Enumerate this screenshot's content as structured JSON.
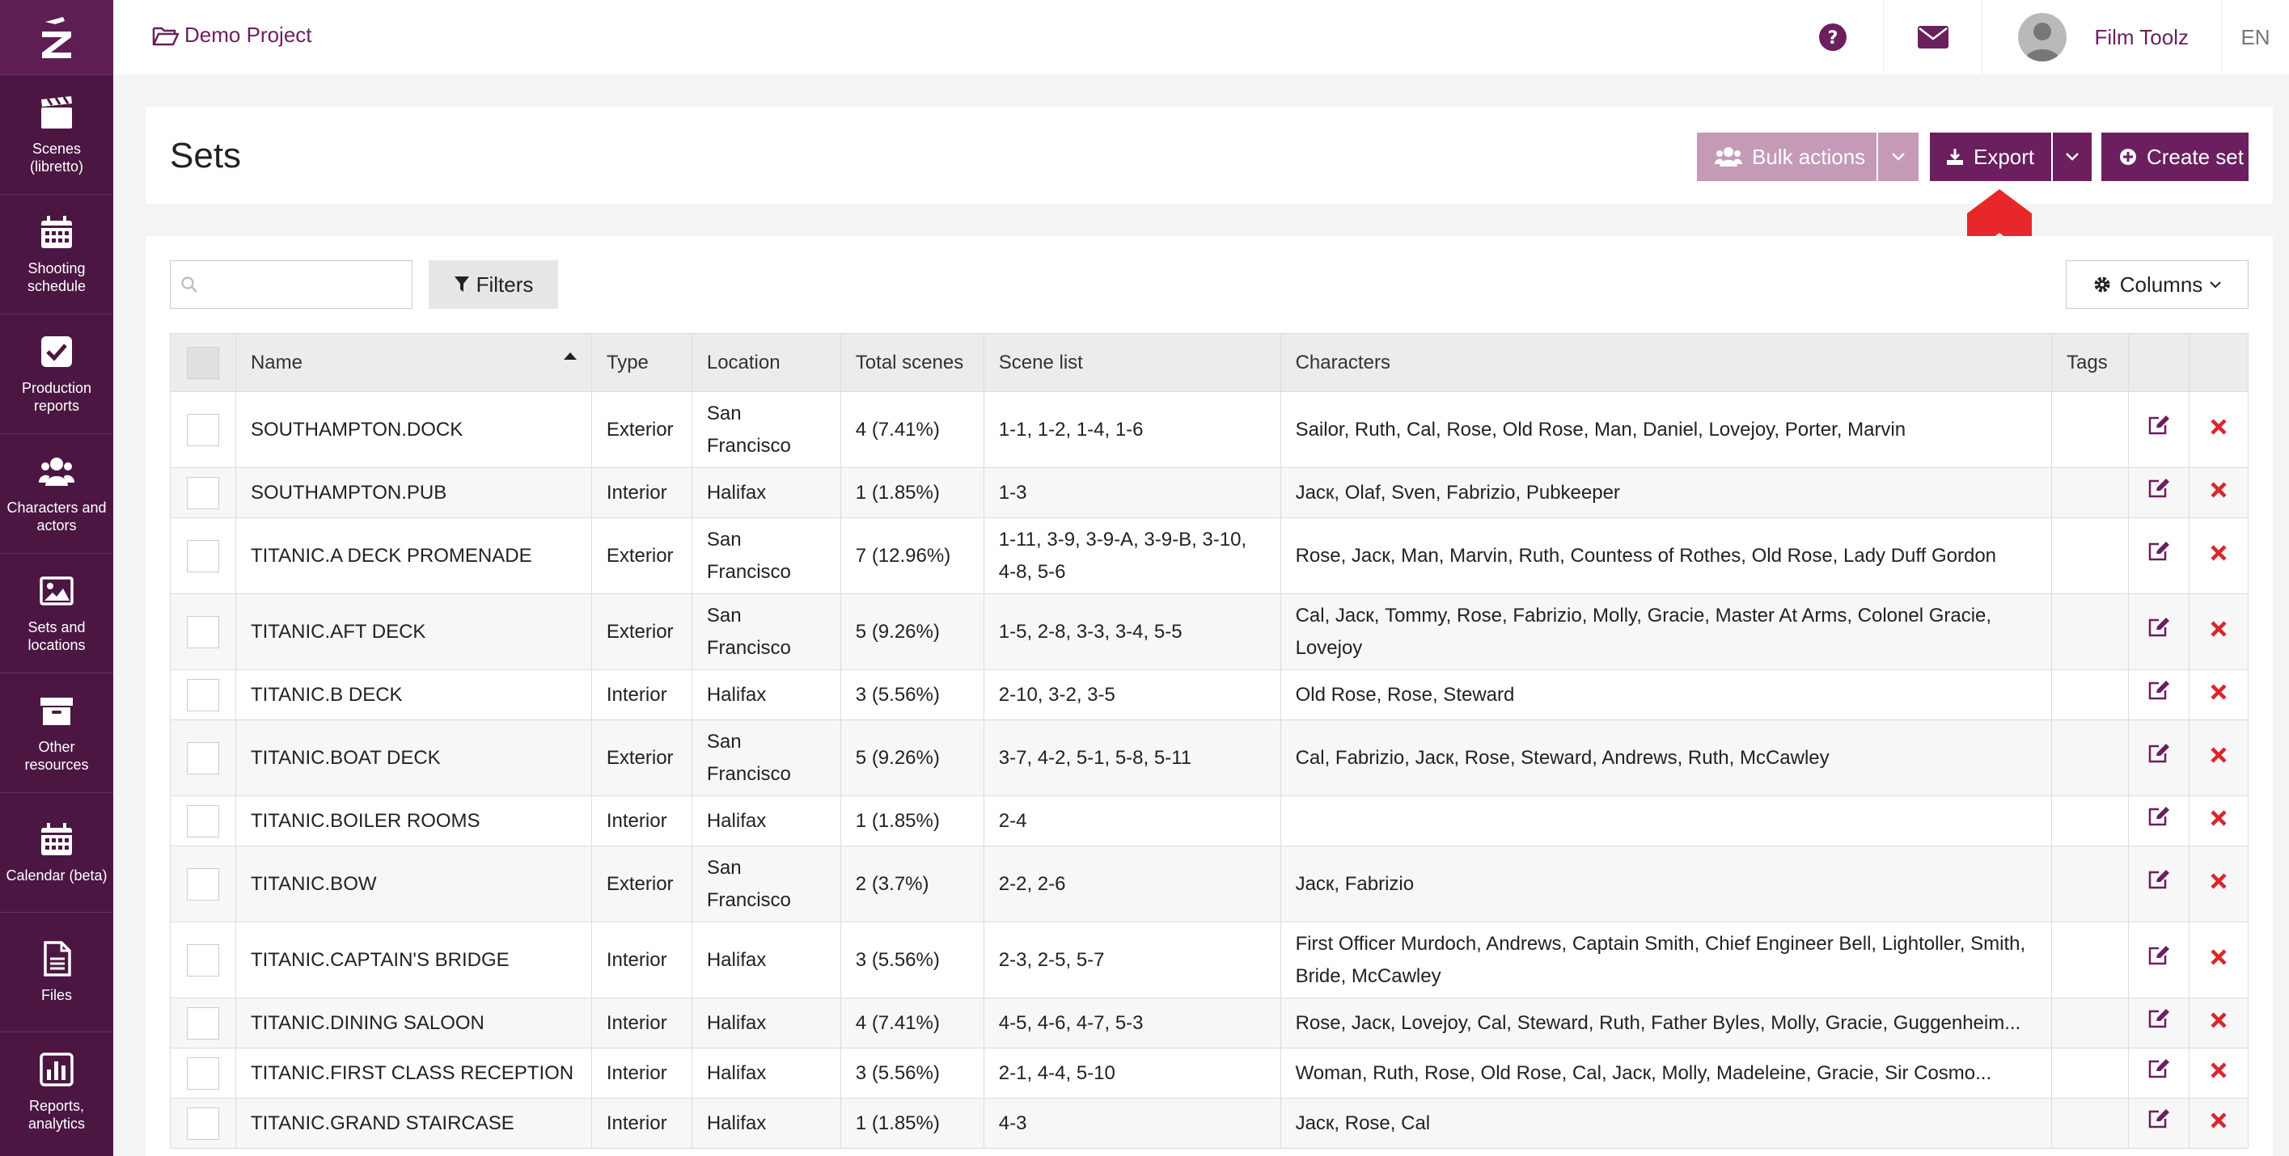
{
  "sidebar": {
    "items": [
      {
        "label": "Scenes (libretto)",
        "icon": "clapperboard-icon"
      },
      {
        "label": "Shooting schedule",
        "icon": "calendar-icon"
      },
      {
        "label": "Production reports",
        "icon": "checkbox-icon"
      },
      {
        "label": "Characters and actors",
        "icon": "users-icon"
      },
      {
        "label": "Sets and locations",
        "icon": "image-icon"
      },
      {
        "label": "Other resources",
        "icon": "archive-icon"
      },
      {
        "label": "Calendar (beta)",
        "icon": "calendar-icon"
      },
      {
        "label": "Files",
        "icon": "file-icon"
      },
      {
        "label": "Reports, analytics",
        "icon": "bar-chart-icon"
      }
    ]
  },
  "topbar": {
    "project": "Demo Project",
    "user": "Film Toolz",
    "lang": "EN"
  },
  "header": {
    "title": "Sets",
    "bulk_actions": "Bulk actions",
    "export": "Export",
    "create_set": "Create set"
  },
  "toolbar": {
    "search_placeholder": "",
    "filters": "Filters",
    "columns": "Columns"
  },
  "table": {
    "headers": {
      "name": "Name",
      "type": "Type",
      "location": "Location",
      "total_scenes": "Total scenes",
      "scene_list": "Scene list",
      "characters": "Characters",
      "tags": "Tags"
    },
    "rows": [
      {
        "name": "SOUTHAMPTON.DOCK",
        "type": "Exterior",
        "location": "San Francisco",
        "total": "4 (7.41%)",
        "scenes": "1-1, 1-2, 1-4, 1-6",
        "characters": "Sailor, Ruth, Cal, Rose, Old Rose, Man, Daniel, Lovejoy, Porter, Marvin"
      },
      {
        "name": "SOUTHAMPTON.PUB",
        "type": "Interior",
        "location": "Halifax",
        "total": "1 (1.85%)",
        "scenes": "1-3",
        "characters": "Jacк, Olaf, Sven, Fabrizio, Pubkeeper"
      },
      {
        "name": "TITANIC.A DECK PROMENADE",
        "type": "Exterior",
        "location": "San Francisco",
        "total": "7 (12.96%)",
        "scenes": "1-11, 3-9, 3-9-A, 3-9-B, 3-10, 4-8, 5-6",
        "characters": "Rose, Jacк, Man, Marvin, Ruth, Countess of Rothes, Old Rose, Lady Duff Gordon"
      },
      {
        "name": "TITANIC.AFT DECK",
        "type": "Exterior",
        "location": "San Francisco",
        "total": "5 (9.26%)",
        "scenes": "1-5, 2-8, 3-3, 3-4, 5-5",
        "characters": "Cal, Jacк, Tommy, Rose, Fabrizio, Molly, Gracie, Master At Arms, Colonel Gracie, Lovejoy"
      },
      {
        "name": "TITANIC.B DECK",
        "type": "Interior",
        "location": "Halifax",
        "total": "3 (5.56%)",
        "scenes": "2-10, 3-2, 3-5",
        "characters": "Old Rose, Rose, Steward"
      },
      {
        "name": "TITANIC.BOAT DECK",
        "type": "Exterior",
        "location": "San Francisco",
        "total": "5 (9.26%)",
        "scenes": "3-7, 4-2, 5-1, 5-8, 5-11",
        "characters": "Cal, Fabrizio, Jacк, Rose, Steward, Andrews, Ruth, McCawley"
      },
      {
        "name": "TITANIC.BOILER ROOMS",
        "type": "Interior",
        "location": "Halifax",
        "total": "1 (1.85%)",
        "scenes": "2-4",
        "characters": ""
      },
      {
        "name": "TITANIC.BOW",
        "type": "Exterior",
        "location": "San Francisco",
        "total": "2 (3.7%)",
        "scenes": "2-2, 2-6",
        "characters": "Jacк, Fabrizio"
      },
      {
        "name": "TITANIC.CAPTAIN'S BRIDGE",
        "type": "Interior",
        "location": "Halifax",
        "total": "3 (5.56%)",
        "scenes": "2-3, 2-5, 5-7",
        "characters": "First Officer Murdoch, Andrews, Captain Smith, Chief Engineer Bell, Lightoller, Smith, Bride, McCawley"
      },
      {
        "name": "TITANIC.DINING SALOON",
        "type": "Interior",
        "location": "Halifax",
        "total": "4 (7.41%)",
        "scenes": "4-5, 4-6, 4-7, 5-3",
        "characters": "Rose, Jacк, Lovejoy, Cal, Steward, Ruth, Father Byles, Molly, Gracie, Guggenheim..."
      },
      {
        "name": "TITANIC.FIRST CLASS RECEPTION",
        "type": "Interior",
        "location": "Halifax",
        "total": "3 (5.56%)",
        "scenes": "2-1, 4-4, 5-10",
        "characters": "Woman, Ruth, Rose, Old Rose, Cal, Jacк, Molly, Madeleine, Gracie, Sir Cosmo..."
      },
      {
        "name": "TITANIC.GRAND STAIRCASE",
        "type": "Interior",
        "location": "Halifax",
        "total": "1 (1.85%)",
        "scenes": "4-3",
        "characters": "Jacк, Rose, Cal"
      }
    ]
  },
  "colors": {
    "sidebar_bg": "#4b1742",
    "accent": "#6b1f5e",
    "bulk_bg": "#c49ab6",
    "delete": "#d9262b",
    "arrow": "#e8272a"
  }
}
